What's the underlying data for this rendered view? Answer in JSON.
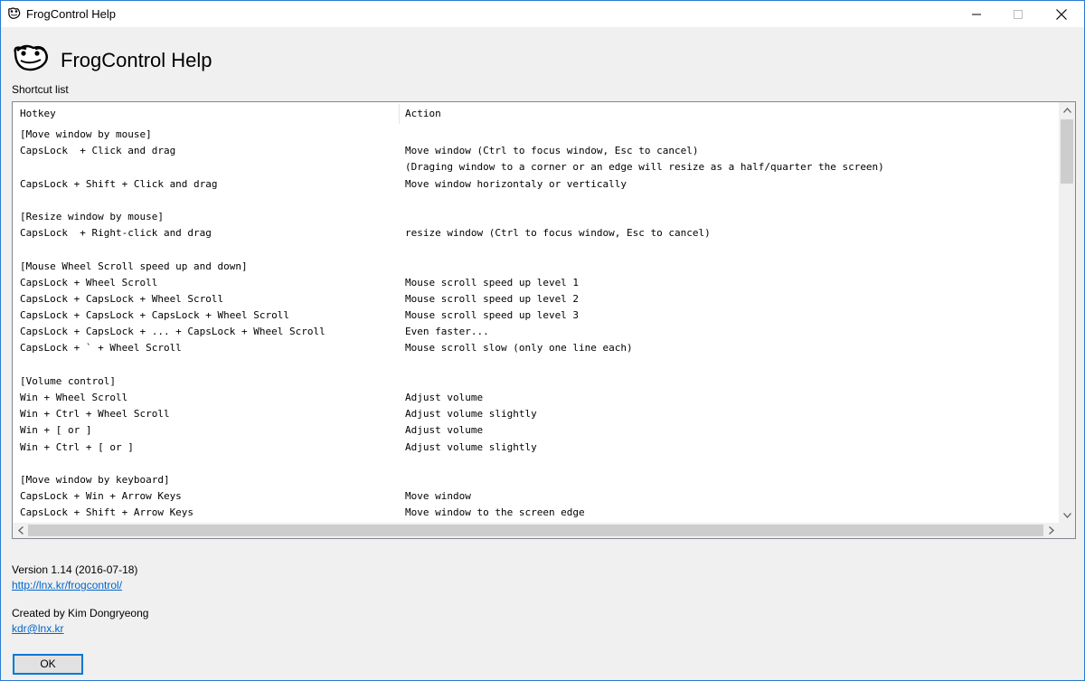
{
  "window": {
    "title": "FrogControl Help"
  },
  "header": {
    "title": "FrogControl Help",
    "shortcut_label": "Shortcut list"
  },
  "list": {
    "columns": [
      "Hotkey",
      "Action"
    ],
    "rows": [
      {
        "hotkey": "[Move window by mouse]",
        "action": ""
      },
      {
        "hotkey": "CapsLock  + Click and drag",
        "action": "Move window (Ctrl to focus window, Esc to cancel)"
      },
      {
        "hotkey": "",
        "action": "(Draging window to a corner or an edge will resize as a half/quarter the screen)"
      },
      {
        "hotkey": "CapsLock + Shift + Click and drag",
        "action": "Move window horizontaly or vertically"
      },
      {
        "hotkey": "",
        "action": ""
      },
      {
        "hotkey": "[Resize window by mouse]",
        "action": ""
      },
      {
        "hotkey": "CapsLock  + Right-click and drag",
        "action": "resize window (Ctrl to focus window, Esc to cancel)"
      },
      {
        "hotkey": "",
        "action": ""
      },
      {
        "hotkey": "[Mouse Wheel Scroll speed up and down]",
        "action": ""
      },
      {
        "hotkey": "CapsLock + Wheel Scroll",
        "action": "Mouse scroll speed up level 1"
      },
      {
        "hotkey": "CapsLock + CapsLock + Wheel Scroll",
        "action": "Mouse scroll speed up level 2"
      },
      {
        "hotkey": "CapsLock + CapsLock + CapsLock + Wheel Scroll",
        "action": "Mouse scroll speed up level 3"
      },
      {
        "hotkey": "CapsLock + CapsLock + ... + CapsLock + Wheel Scroll",
        "action": "Even faster..."
      },
      {
        "hotkey": "CapsLock + ` + Wheel Scroll",
        "action": "Mouse scroll slow (only one line each)"
      },
      {
        "hotkey": "",
        "action": ""
      },
      {
        "hotkey": "[Volume control]",
        "action": ""
      },
      {
        "hotkey": "Win + Wheel Scroll",
        "action": "Adjust volume"
      },
      {
        "hotkey": "Win + Ctrl + Wheel Scroll",
        "action": "Adjust volume slightly"
      },
      {
        "hotkey": "Win + [ or ]",
        "action": "Adjust volume"
      },
      {
        "hotkey": "Win + Ctrl + [ or ]",
        "action": "Adjust volume slightly"
      },
      {
        "hotkey": "",
        "action": ""
      },
      {
        "hotkey": "[Move window by keyboard]",
        "action": ""
      },
      {
        "hotkey": "CapsLock + Win + Arrow Keys",
        "action": "Move window"
      },
      {
        "hotkey": "CapsLock + Shift + Arrow Keys",
        "action": "Move window to the screen edge"
      }
    ]
  },
  "footer": {
    "version": "Version 1.14 (2016-07-18)",
    "url": "http://lnx.kr/frogcontrol/",
    "created_by": "Created by Kim Dongryeong",
    "email": "kdr@lnx.kr"
  },
  "buttons": {
    "ok": "OK"
  },
  "icons": {
    "app": "frog-icon",
    "minimize": "minimize-icon",
    "maximize": "maximize-icon",
    "close": "close-icon"
  },
  "colors": {
    "link": "#0066cc",
    "focus": "#0078d7",
    "window_border": "#2b79d0"
  }
}
